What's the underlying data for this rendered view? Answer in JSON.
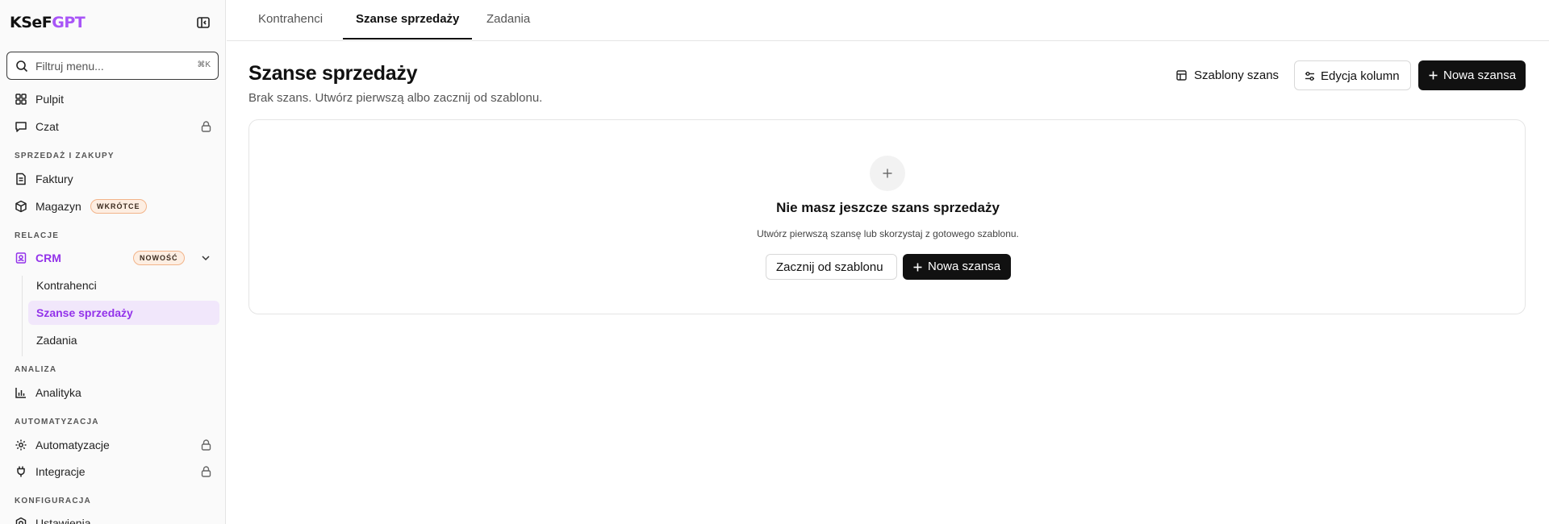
{
  "brand": {
    "ksef": "KSeF",
    "gpt": "GPT"
  },
  "sidebar": {
    "filter_placeholder": "Filtruj menu...",
    "shortcut": "⌘K",
    "items": {
      "pulpit": "Pulpit",
      "czat": "Czat",
      "faktury": "Faktury",
      "magazyn": "Magazyn",
      "crm": "CRM",
      "analityka": "Analityka",
      "automatyzacje": "Automatyzacje",
      "integracje": "Integracje",
      "ustawienia": "Ustawienia"
    },
    "badges": {
      "magazyn": "WKRÓTCE",
      "crm": "NOWOŚĆ"
    },
    "sections": {
      "sprzedaz": "SPRZEDAŻ I ZAKUPY",
      "relacje": "RELACJE",
      "analiza": "ANALIZA",
      "automatyzacja": "AUTOMATYZACJA",
      "konfiguracja": "KONFIGURACJA"
    },
    "crm_sub": [
      "Kontrahenci",
      "Szanse sprzedaży",
      "Zadania"
    ]
  },
  "tabs": [
    "Kontrahenci",
    "Szanse sprzedaży",
    "Zadania"
  ],
  "page": {
    "title": "Szanse sprzedaży",
    "subtitle": "Brak szans. Utwórz pierwszą albo zacznij od szablonu."
  },
  "actions": {
    "templates": "Szablony szans",
    "edit_columns": "Edycja kolumn",
    "new_opportunity": "Nowa szansa"
  },
  "empty_state": {
    "title": "Nie masz jeszcze szans sprzedaży",
    "description": "Utwórz pierwszą szansę lub skorzystaj z gotowego szablonu.",
    "from_template": "Zacznij od szablonu",
    "new_opportunity": "Nowa szansa"
  },
  "colors": {
    "accent": "#9333ea",
    "accent_bg": "#f1e7fb",
    "badge_bg": "#fdeee2",
    "badge_border": "#f2b48a",
    "dark_button": "#111111"
  }
}
